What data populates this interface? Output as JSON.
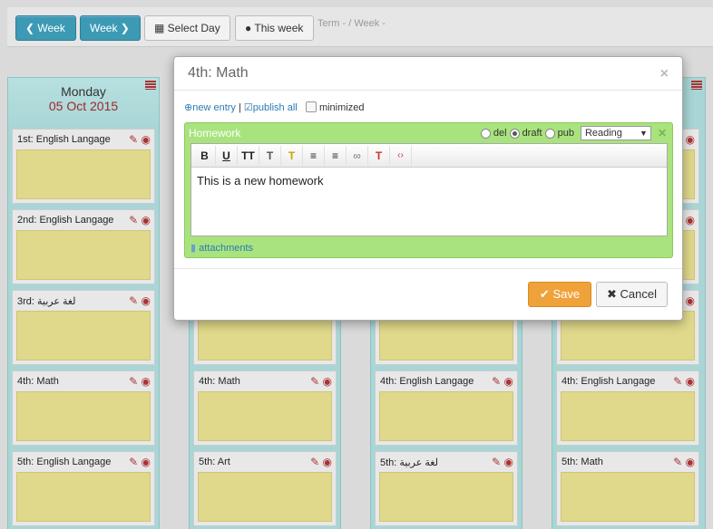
{
  "toolbar": {
    "prev_week": "Week",
    "next_week": "Week",
    "select_day": "Select Day",
    "this_week": "This week",
    "term_label": "Term - / Week -"
  },
  "columns": [
    {
      "day": "Monday",
      "date": "05 Oct 2015",
      "slots": [
        "1st: English Langage",
        "2nd: English Langage",
        "3rd: لغة عربية",
        "4th: Math",
        "5th: English Langage"
      ]
    },
    {
      "slots": [
        "4th: Math",
        "5th: Art"
      ]
    },
    {
      "slots": [
        "4th: English Langage",
        "5th: لغة عربية"
      ]
    },
    {
      "slots": [
        "4th: English Langage",
        "5th: Math"
      ]
    }
  ],
  "modal": {
    "title": "4th: Math",
    "new_entry": "new entry",
    "separator": "|",
    "publish_all": "publish all",
    "minimized": "minimized",
    "entry": {
      "type": "Homework",
      "del": "del",
      "draft": "draft",
      "pub": "pub",
      "category": "Reading",
      "body": "This is a new homework",
      "attachments": "attachments"
    },
    "save": "Save",
    "cancel": "Cancel"
  },
  "colors": {
    "accent_blue": "#3c9ab5",
    "save_orange": "#f0a23a",
    "entry_green": "#a9e37e",
    "note_yellow": "#e0d88a",
    "column_teal": "#a8d6d6"
  }
}
